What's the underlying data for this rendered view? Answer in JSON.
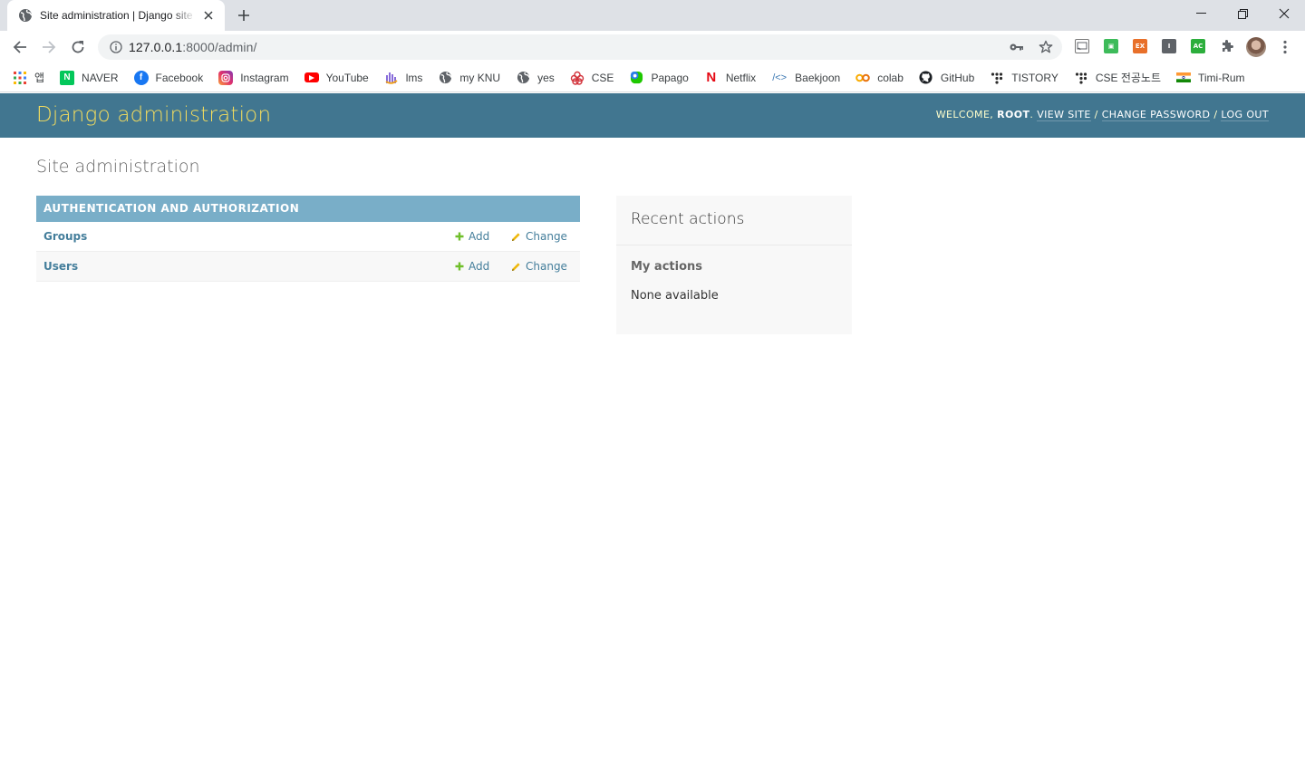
{
  "browser": {
    "tab_title": "Site administration | Django site admin",
    "url_host": "127.0.0.1",
    "url_rest": ":8000/admin/",
    "bookmarks": [
      {
        "label": "앱",
        "icon": "apps-grid-icon"
      },
      {
        "label": "NAVER",
        "icon": "naver-icon"
      },
      {
        "label": "Facebook",
        "icon": "facebook-icon"
      },
      {
        "label": "Instagram",
        "icon": "instagram-icon"
      },
      {
        "label": "YouTube",
        "icon": "youtube-icon"
      },
      {
        "label": "lms",
        "icon": "lms-icon"
      },
      {
        "label": "my KNU",
        "icon": "globe-icon"
      },
      {
        "label": "yes",
        "icon": "globe-icon"
      },
      {
        "label": "CSE",
        "icon": "cse-icon"
      },
      {
        "label": "Papago",
        "icon": "papago-icon"
      },
      {
        "label": "Netflix",
        "icon": "netflix-icon"
      },
      {
        "label": "Baekjoon",
        "icon": "code-icon"
      },
      {
        "label": "colab",
        "icon": "colab-icon"
      },
      {
        "label": "GitHub",
        "icon": "github-icon"
      },
      {
        "label": "TISTORY",
        "icon": "tistory-icon"
      },
      {
        "label": "CSE 전공노트",
        "icon": "tistory-icon"
      },
      {
        "label": "Timi-Rum",
        "icon": "flag-icon"
      }
    ]
  },
  "header": {
    "branding": "Django administration",
    "welcome": "Welcome,",
    "username": "root",
    "view_site": "View site",
    "change_password": "Change password",
    "log_out": "Log out"
  },
  "page": {
    "title": "Site administration"
  },
  "app_module": {
    "caption": "Authentication and Authorization",
    "models": [
      {
        "name": "Groups",
        "add": "Add",
        "change": "Change"
      },
      {
        "name": "Users",
        "add": "Add",
        "change": "Change"
      }
    ]
  },
  "recent_actions": {
    "title": "Recent actions",
    "subtitle": "My actions",
    "empty": "None available"
  },
  "colors": {
    "header_bg": "#417690",
    "branding": "#f5dd5d",
    "caption_bg": "#79aec8",
    "link": "#447e9b",
    "add_icon": "#70bf2b",
    "change_icon": "#efb80b"
  }
}
